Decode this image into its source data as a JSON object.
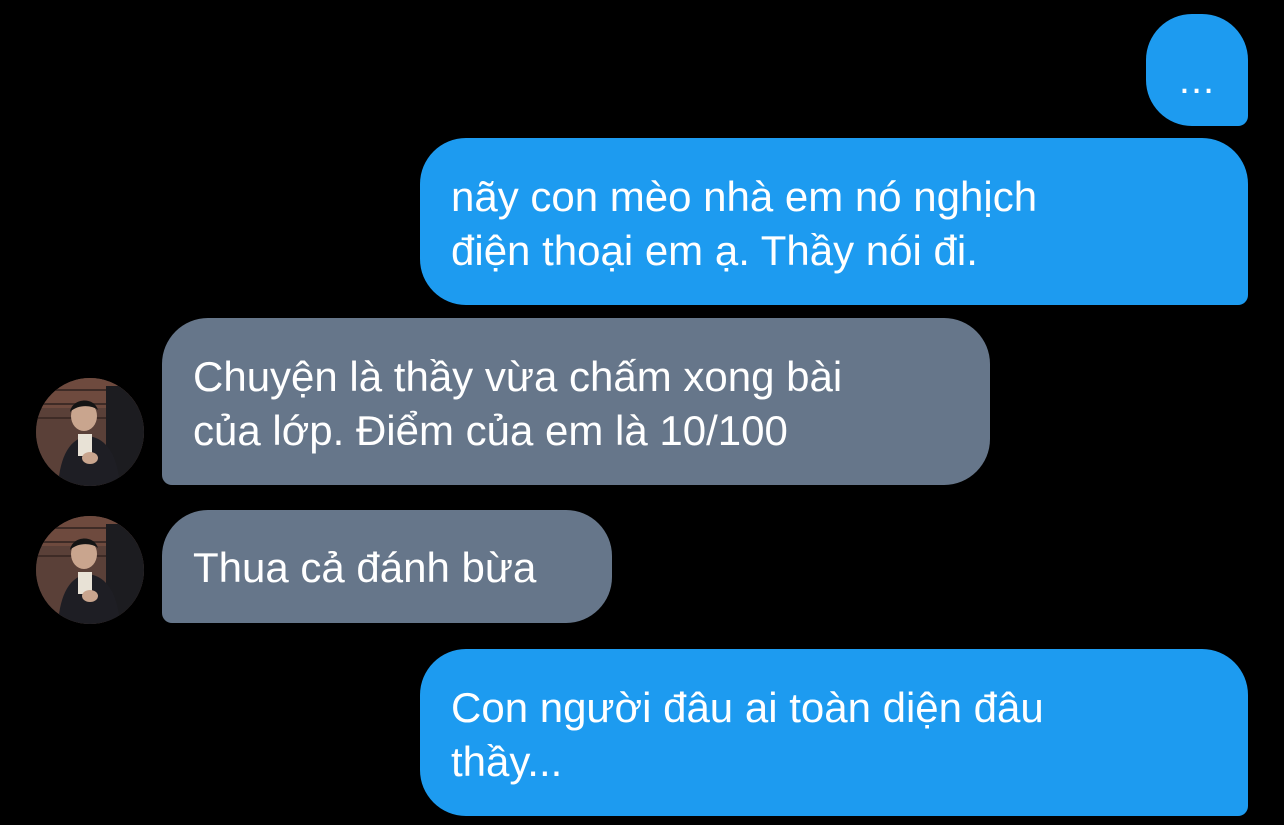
{
  "messages": [
    {
      "id": "m1",
      "direction": "outgoing",
      "lines": [
        "..."
      ]
    },
    {
      "id": "m2",
      "direction": "outgoing",
      "lines": [
        "nãy con mèo nhà em nó nghịch",
        "điện thoại em ạ. Thầy nói đi."
      ]
    },
    {
      "id": "m3",
      "direction": "incoming",
      "lines": [
        "Chuyện là thầy vừa chấm xong bài",
        "của lớp. Điểm của em là 10/100"
      ]
    },
    {
      "id": "m4",
      "direction": "incoming",
      "lines": [
        "Thua cả đánh bừa"
      ]
    },
    {
      "id": "m5",
      "direction": "outgoing",
      "lines": [
        "Con người đâu ai toàn diện đâu",
        "thầy..."
      ]
    }
  ],
  "colors": {
    "background": "#000000",
    "outgoing_bubble": "#1d9bf0",
    "incoming_bubble": "#66768a",
    "text": "#ffffff"
  }
}
